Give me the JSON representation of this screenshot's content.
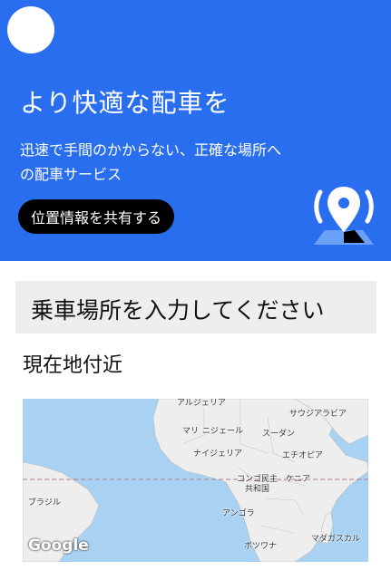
{
  "hero": {
    "title": "より快適な配車を",
    "subtitle_line1": "迅速で手間のかからない、正確な場所へ",
    "subtitle_line2": "の配車サービス",
    "share_button": "位置情報を共有する",
    "background_color": "#2a6ef0"
  },
  "pickup": {
    "label": "乗車場所を入力してください"
  },
  "nearby": {
    "label": "現在地付近"
  },
  "map": {
    "labels": {
      "algeria": "アルジェリア",
      "saudi": "サウジアラビア",
      "mali": "マリ",
      "niger": "ニジェール",
      "sudan": "スーダン",
      "nigeria": "ナイジェリア",
      "ethiopia": "エチオピア",
      "congo": "コンゴ民主\n共和国",
      "kenya": "ケニア",
      "brazil": "ブラジル",
      "angola": "アンゴラ",
      "madagascar": "マダガスカル",
      "botswana": "ボツワナ"
    },
    "logo": "Google",
    "water_color": "#a9d2f2",
    "land_color": "#eeeeee"
  },
  "icons": {
    "avatar": "avatar-circle",
    "location": "location-pin-icon"
  }
}
